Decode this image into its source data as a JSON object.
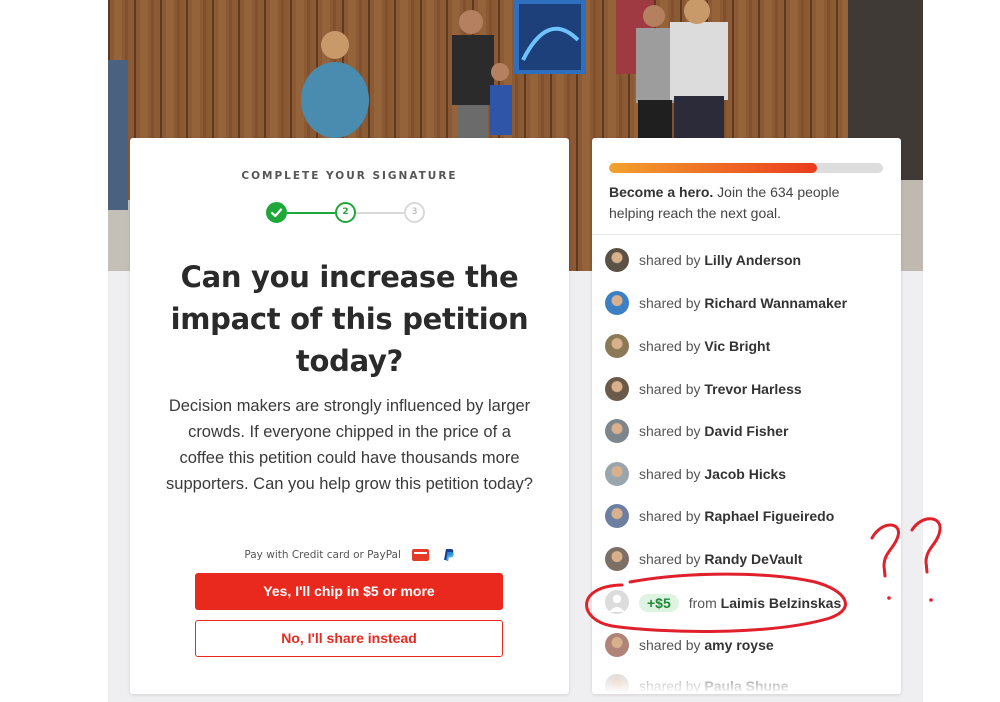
{
  "signature": {
    "eyebrow": "COMPLETE YOUR SIGNATURE",
    "steps": [
      "",
      "2",
      "3"
    ],
    "headline": "Can you increase the impact of this petition today?",
    "body": "Decision makers are strongly influenced by larger crowds. If everyone chipped in the price of a coffee this petition could have thousands more supporters. Can you help grow this petition today?",
    "pay_label": "Pay with Credit card or PayPal",
    "primary_button": "Yes, I'll chip in $5 or more",
    "secondary_button": "No, I'll share instead"
  },
  "supporters": {
    "progress_fraction": 0.76,
    "goal_strong": "Become a hero.",
    "goal_rest": " Join the 634 people helping reach the next goal.",
    "shared_prefix": "shared by",
    "from_prefix": "from",
    "rows": [
      {
        "type": "share",
        "name": "Lilly Anderson",
        "avatar_color": "#5a5147"
      },
      {
        "type": "share",
        "name": "Richard Wannamaker",
        "avatar_color": "#3d7fc4"
      },
      {
        "type": "share",
        "name": "Vic Bright",
        "avatar_color": "#8a7a58"
      },
      {
        "type": "share",
        "name": "Trevor Harless",
        "avatar_color": "#6b5a4a"
      },
      {
        "type": "share",
        "name": "David Fisher",
        "avatar_color": "#7d868c"
      },
      {
        "type": "share",
        "name": "Jacob Hicks",
        "avatar_color": "#9aa6ad"
      },
      {
        "type": "share",
        "name": "Raphael Figueiredo",
        "avatar_color": "#6d7fa0"
      },
      {
        "type": "share",
        "name": "Randy DeVault",
        "avatar_color": "#7b6f66"
      },
      {
        "type": "donation",
        "amount": "+$5",
        "name": "Laimis Belzinskas",
        "avatar_color": "#d6d6d6"
      },
      {
        "type": "share",
        "name": "amy royse",
        "avatar_color": "#b08478"
      },
      {
        "type": "share",
        "name": "Paula Shupe",
        "avatar_color": "#c9c2bb"
      }
    ]
  },
  "annotation": {
    "text": "??",
    "color": "#e0202a"
  },
  "colors": {
    "accent_red": "#e9291e",
    "success_green": "#1fa83a",
    "page_bg": "#efeef0"
  }
}
